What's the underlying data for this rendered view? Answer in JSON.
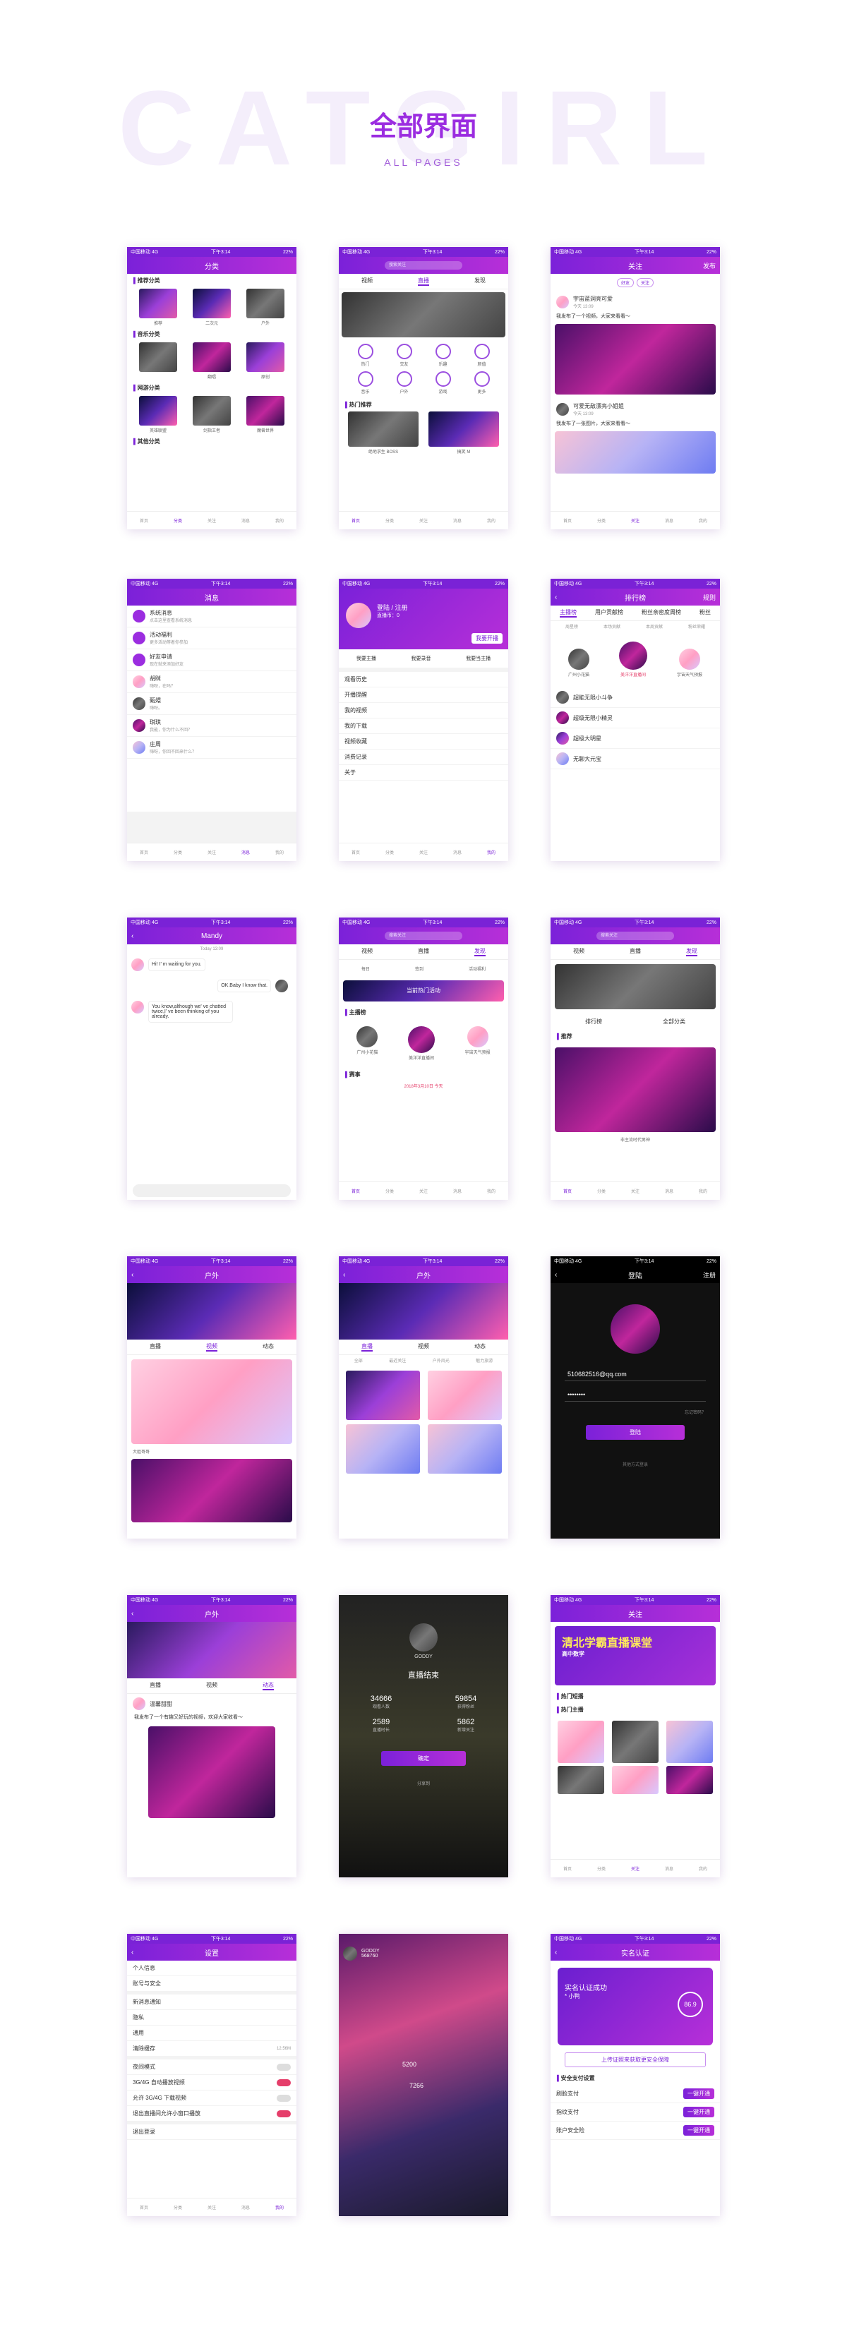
{
  "watermark": "CATGIRL",
  "header": {
    "title": "全部界面",
    "subtitle": "ALL PAGES"
  },
  "status": {
    "carrier": "中国移动 4G",
    "time": "下午3:14",
    "battery": "22%"
  },
  "screen1": {
    "nav": "分类",
    "sections": [
      {
        "title": "推荐分类",
        "items": [
          "推荐",
          "二次元",
          "户外"
        ]
      },
      {
        "title": "音乐分类",
        "items": [
          "",
          "翻唱",
          "原创"
        ]
      },
      {
        "title": "网游分类",
        "items": [
          "英雄联盟",
          "剑指王者",
          "魔兽世界"
        ]
      },
      {
        "title": "其他分类",
        "items": []
      }
    ]
  },
  "bottom_nav": [
    "首页",
    "分类",
    "关注",
    "消息",
    "我的"
  ],
  "screen2": {
    "search": "搜索关注",
    "tabs": [
      "视频",
      "直播",
      "发现"
    ],
    "categories": [
      "热门",
      "交友",
      "乐趣",
      "颜值",
      "音乐",
      "户外",
      "游戏",
      "更多"
    ],
    "hot_title": "热门推荐",
    "items": [
      "绝地求生 BOSS",
      "搞笑 M"
    ]
  },
  "screen3": {
    "nav": "关注",
    "right": "发布",
    "tabs": [
      "好友",
      "关注"
    ],
    "posts": [
      {
        "name": "宇宙蓝洞亮可爱",
        "time": "今天 13:09",
        "text": "我发布了一个视频，大家来看看～"
      },
      {
        "name": "可爱无敌漂亮小姐姐",
        "time": "今天 13:09",
        "text": "我发布了一张图片，大家来看看～"
      }
    ]
  },
  "screen4": {
    "nav": "消息",
    "items": [
      {
        "name": "系统消息",
        "text": "点击这里查看系统消息"
      },
      {
        "name": "活动福利",
        "text": "更多活动等着你参加"
      },
      {
        "name": "好友申请",
        "text": "现在就来添加好友"
      },
      {
        "name": "胡眯",
        "text": "嗨呀，在吗？"
      },
      {
        "name": "甄嬛",
        "text": "嗨呀。"
      },
      {
        "name": "琪琪",
        "text": "我能，你为什么不回？"
      },
      {
        "name": "庄周",
        "text": "嗨呀，你回不回来什么？"
      }
    ]
  },
  "screen5": {
    "login": "登陆 / 注册",
    "stats": "直播币：0",
    "button": "我要开播",
    "actions": [
      "我要主播",
      "我要录音",
      "我要当主播"
    ],
    "menu": [
      "观看历史",
      "开播提醒",
      "我的视频",
      "我的下载",
      "视频收藏",
      "消费记录",
      "关于"
    ]
  },
  "screen6": {
    "nav": "排行榜",
    "right": "规则",
    "tabs": [
      "主播榜",
      "用户贡献榜",
      "粉丝亲密度周榜",
      "粉丝"
    ],
    "subtabs": [
      "周星榜",
      "本场贡献",
      "本周贡献",
      "粉丝荣耀"
    ],
    "top3": [
      "广州小花猫",
      "美洋洋直播间",
      "宇宙天气预报"
    ],
    "list": [
      "超能无限小斗争",
      "超级无限小精灵",
      "超级大明星",
      "无聊大元宝"
    ]
  },
  "screen7": {
    "nav": "Mandy",
    "time": "Today 13:09",
    "messages": [
      "Hi! I' m waiting for you.",
      "OK.Baby I know that.",
      "You know,although we' ve chatted twice,I' ve been thinking of you already."
    ]
  },
  "screen8": {
    "search": "搜索关注",
    "tabs": [
      "视频",
      "直播",
      "发现"
    ],
    "icons": [
      "每日",
      "签到",
      "活动福利"
    ],
    "banner": "当前热门活动",
    "rank_title": "主播榜",
    "top3": [
      "广州小花猫",
      "美洋洋直播间",
      "宇宙天气预报"
    ],
    "event_title": "赛事",
    "event": "2018年3月10日 今天"
  },
  "screen9": {
    "tabs": [
      "视频",
      "直播",
      "发现"
    ],
    "menu": [
      "排行榜",
      "全部分类"
    ],
    "rec": "推荐",
    "item": "非主流时代男神"
  },
  "screen10": {
    "nav": "户外",
    "tabs": [
      "直播",
      "视频",
      "动态"
    ],
    "item": "大姐哥哥"
  },
  "screen11": {
    "nav": "户外",
    "tabs": [
      "直播",
      "视频",
      "动态"
    ],
    "sub": [
      "全部",
      "最近关注",
      "户外风光",
      "魅力旅游"
    ]
  },
  "screen12": {
    "nav": "登陆",
    "right": "注册",
    "email": "510682516@qq.com",
    "password": "••••••••",
    "forgot": "忘记密码？",
    "button": "登陆",
    "other": "其他方式登录"
  },
  "screen13": {
    "nav": "户外",
    "tabs": [
      "直播",
      "视频",
      "动态"
    ],
    "name": "温馨甜甜",
    "text": "我发布了一个有趣又好玩的视频，欢迎大家收看～"
  },
  "screen14": {
    "name": "GODDY",
    "ended": "直播结束",
    "stats": [
      [
        "34666",
        "观看人数"
      ],
      [
        "59854",
        "获得粉丝"
      ],
      [
        "2589",
        "直播时长"
      ],
      [
        "5862",
        "新增关注"
      ]
    ],
    "button": "确定",
    "share": "分享到"
  },
  "screen15": {
    "nav": "关注",
    "banner_title": "清北学霸直播课堂",
    "banner_tag": "高中数学",
    "section1": "热门短播",
    "section2": "热门主播"
  },
  "screen16": {
    "nav": "设置",
    "items": [
      "个人信息",
      "账号与安全",
      "新消息通知",
      "隐私",
      "通用",
      "清除缓存",
      "夜间模式",
      "3G/4G 自动播放视频",
      "允许 3G/4G 下载视频",
      "退出直播间允许小窗口播放",
      "退出登录"
    ],
    "cache": "12.56M"
  },
  "screen17": {
    "name": "GODDY",
    "id": "568760",
    "viewers": "5200",
    "likes": "7266"
  },
  "screen18": {
    "nav": "实名认证",
    "card_title": "实名认证成功",
    "card_name": "* 小鸭",
    "score": "86.9",
    "button": "上传证照来获取更安全保障",
    "section": "安全支付设置",
    "items": [
      "刷脸支付",
      "指纹支付",
      "账户安全险"
    ],
    "btn": "一键开通"
  },
  "colors": {
    "accent": "#7b21d9",
    "pink": "#e53e6a"
  }
}
